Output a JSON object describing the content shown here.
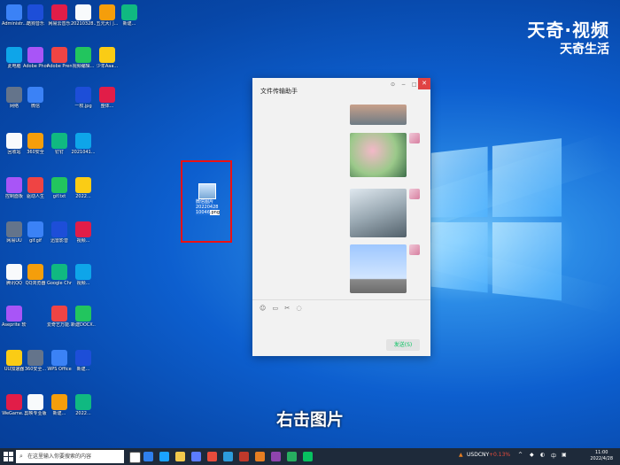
{
  "watermark": {
    "line1": "天奇·视频",
    "line2": "天奇生活"
  },
  "desktop_icons": [
    {
      "label": "Administr..."
    },
    {
      "label": "酷狗音乐"
    },
    {
      "label": "网易云音乐"
    },
    {
      "label": "20210328..."
    },
    {
      "label": "五元大门..."
    },
    {
      "label": "新建..."
    },
    {
      "label": "此电脑"
    },
    {
      "label": "Adobe Photosh..."
    },
    {
      "label": "Adobe Premiere..."
    },
    {
      "label": "视频编辑..."
    },
    {
      "label": "少年Aaa..."
    },
    {
      "label": "网络"
    },
    {
      "label": "微信"
    },
    {
      "label": "一枚.jpg"
    },
    {
      "label": "整体..."
    },
    {
      "label": "回收站"
    },
    {
      "label": "360安全"
    },
    {
      "label": "钉钉"
    },
    {
      "label": "2021041..."
    },
    {
      "label": "控制面板"
    },
    {
      "label": "驱动人生"
    },
    {
      "label": "gif.txt"
    },
    {
      "label": "2022..."
    },
    {
      "label": "网易UU"
    },
    {
      "label": "gif.gif"
    },
    {
      "label": "迅雷影音"
    },
    {
      "label": "视频..."
    },
    {
      "label": "腾讯QQ"
    },
    {
      "label": "QQ浏览器"
    },
    {
      "label": "Google Chrome"
    },
    {
      "label": "视频..."
    },
    {
      "label": "Aseprite 软件"
    },
    {
      "label": "爱奇艺万能..."
    },
    {
      "label": "新建DOCX..."
    },
    {
      "label": "UU加速器"
    },
    {
      "label": "360安全..."
    },
    {
      "label": "WPS Office"
    },
    {
      "label": "新建..."
    },
    {
      "label": "WeGame..."
    },
    {
      "label": "剪映专业版"
    },
    {
      "label": "新建..."
    },
    {
      "label": "2022..."
    }
  ],
  "dragged_file": {
    "label_line1": "微信图片",
    "label_line2": "20220428",
    "label_line3": "10046",
    "label_ext": ".png"
  },
  "chat_window": {
    "title": "文件传输助手",
    "controls": {
      "pin": "⊙",
      "minimize": "−",
      "maximize": "□",
      "close": "✕"
    },
    "toolbar_icons": [
      "emoji-icon",
      "folder-icon",
      "scissors-icon",
      "chat-bubble-icon"
    ],
    "send_label": "发送(S)"
  },
  "subtitle": "右击图片",
  "taskbar": {
    "search_placeholder": "在这里输入你要搜索的内容",
    "ticker": "USDCNY",
    "ticker_change": "+0.13%",
    "time": "11:00",
    "date": "2022/4/28"
  }
}
